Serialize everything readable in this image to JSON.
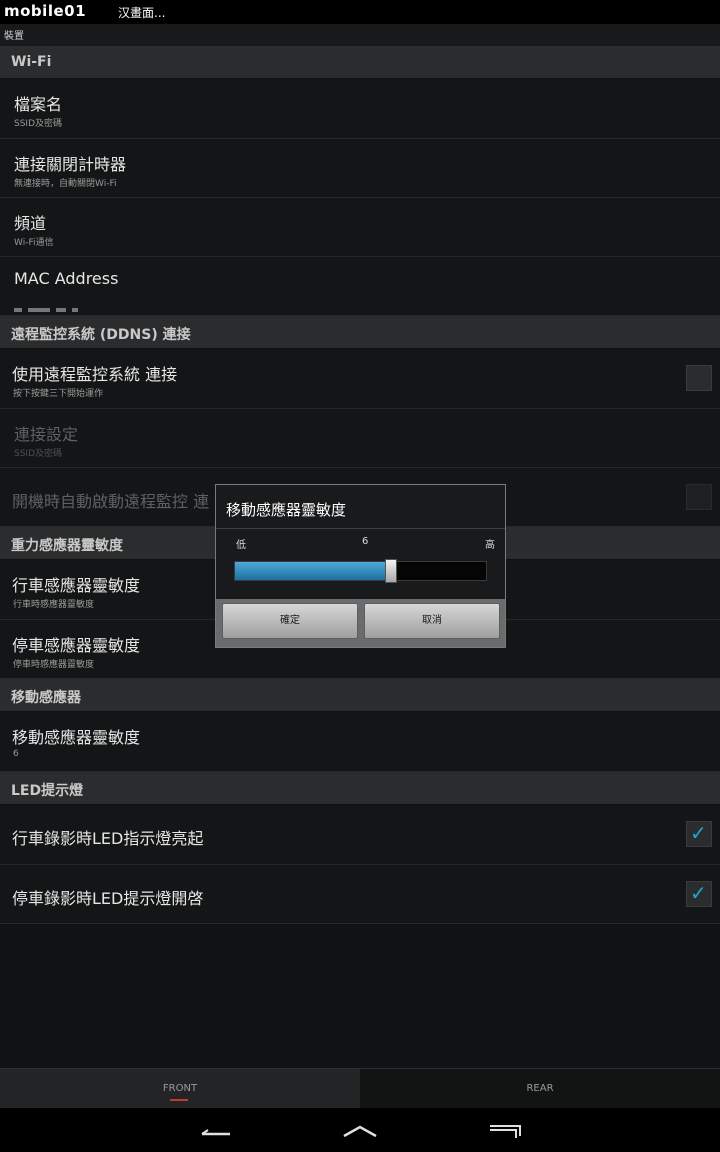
{
  "statusbar": {
    "logo": "mobile01",
    "notice": "汉畫面..."
  },
  "titlebar": {
    "title": "裝置"
  },
  "sections": {
    "wifi": "Wi-Fi",
    "ddns": "遠程監控系統 (DDNS) 連接",
    "gsensor": "重力感應器靈敏度",
    "motion": "移動感應器",
    "led": "LED提示燈"
  },
  "items": {
    "ssid": {
      "title": "檔案名",
      "sub": "SSID及密碼"
    },
    "timer": {
      "title": "連接關閉計時器",
      "sub": "無連接時，自動關閉Wi-Fi"
    },
    "channel": {
      "title": "頻道",
      "sub": "Wi-Fi通信"
    },
    "mac": {
      "title": "MAC Address"
    },
    "use_ddns": {
      "title": "使用遠程監控系統 連接",
      "sub": "按下按鍵三下開始運作",
      "checked": false
    },
    "conn_settings": {
      "title": "連接設定",
      "sub": "SSID及密碼"
    },
    "autostart": {
      "title": "開機時自動啟動遠程監控 連",
      "checked": false
    },
    "drive_sense": {
      "title": "行車感應器靈敏度",
      "sub": "行車時感應器靈敏度"
    },
    "park_sense": {
      "title": "停車感應器靈敏度",
      "sub": "停車時感應器靈敏度"
    },
    "motion_sense": {
      "title": "移動感應器靈敏度",
      "sub": "6"
    },
    "led_drive": {
      "title": "行車錄影時LED指示燈亮起",
      "checked": true
    },
    "led_park": {
      "title": "停車錄影時LED提示燈開啓",
      "checked": true
    }
  },
  "dialog": {
    "title": "移動感應器靈敏度",
    "low_label": "低",
    "value": "6",
    "high_label": "高",
    "slider_fraction": 0.62,
    "ok_label": "確定",
    "cancel_label": "取消"
  },
  "tabs": {
    "front": "FRONT",
    "rear": "REAR"
  },
  "colors": {
    "accent": "#1fa6d6",
    "slider_fill": "#3a93c8",
    "background": "#111213"
  }
}
